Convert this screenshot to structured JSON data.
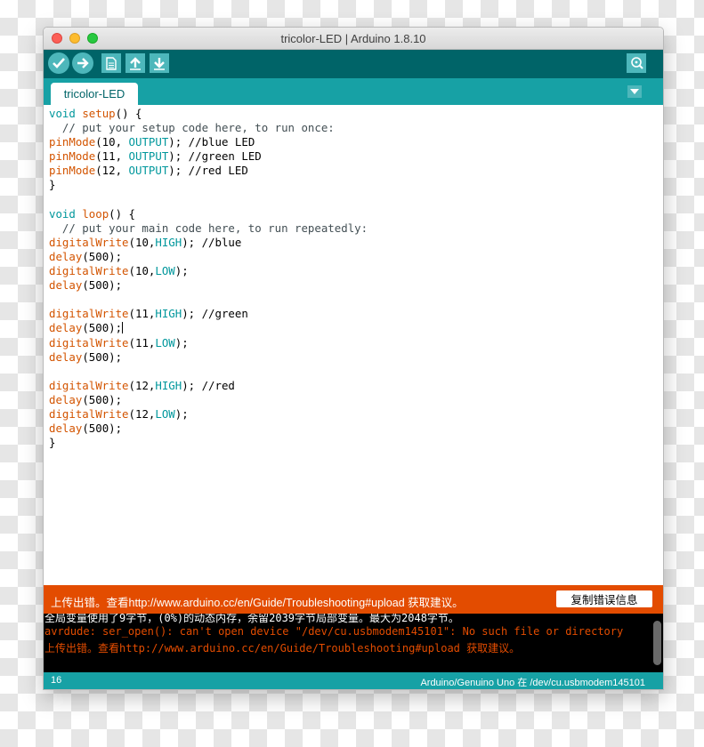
{
  "window": {
    "title": "tricolor-LED | Arduino 1.8.10"
  },
  "toolbar": {
    "buttons": [
      {
        "name": "verify",
        "icon": "checkmark-icon"
      },
      {
        "name": "upload",
        "icon": "arrow-right-icon"
      },
      {
        "name": "new",
        "icon": "document-icon"
      },
      {
        "name": "open",
        "icon": "arrow-up-icon"
      },
      {
        "name": "save",
        "icon": "arrow-down-icon"
      },
      {
        "name": "serial-monitor",
        "icon": "magnifier-icon"
      }
    ]
  },
  "tabs": {
    "active": "tricolor-LED",
    "menu_icon": "triangle-down-icon"
  },
  "editor": {
    "lines": [
      [
        {
          "t": "void",
          "c": "kw"
        },
        {
          "t": " "
        },
        {
          "t": "setup",
          "c": "fn"
        },
        {
          "t": "() {"
        }
      ],
      [
        {
          "t": "  // put your setup code here, to run once:",
          "c": "cm"
        }
      ],
      [
        {
          "t": "pinMode",
          "c": "fn"
        },
        {
          "t": "(10, "
        },
        {
          "t": "OUTPUT",
          "c": "kw"
        },
        {
          "t": "); //blue LED",
          "c": ""
        }
      ],
      [
        {
          "t": "pinMode",
          "c": "fn"
        },
        {
          "t": "(11, "
        },
        {
          "t": "OUTPUT",
          "c": "kw"
        },
        {
          "t": "); //green LED"
        }
      ],
      [
        {
          "t": "pinMode",
          "c": "fn"
        },
        {
          "t": "(12, "
        },
        {
          "t": "OUTPUT",
          "c": "kw"
        },
        {
          "t": "); //red LED"
        }
      ],
      [
        {
          "t": "}"
        }
      ],
      [
        {
          "t": ""
        }
      ],
      [
        {
          "t": "void",
          "c": "kw"
        },
        {
          "t": " "
        },
        {
          "t": "loop",
          "c": "fn"
        },
        {
          "t": "() {"
        }
      ],
      [
        {
          "t": "  // put your main code here, to run repeatedly:",
          "c": "cm"
        }
      ],
      [
        {
          "t": "digitalWrite",
          "c": "fn"
        },
        {
          "t": "(10,"
        },
        {
          "t": "HIGH",
          "c": "kw"
        },
        {
          "t": "); //blue"
        }
      ],
      [
        {
          "t": "delay",
          "c": "fn"
        },
        {
          "t": "(500);"
        }
      ],
      [
        {
          "t": "digitalWrite",
          "c": "fn"
        },
        {
          "t": "(10,"
        },
        {
          "t": "LOW",
          "c": "kw"
        },
        {
          "t": ");"
        }
      ],
      [
        {
          "t": "delay",
          "c": "fn"
        },
        {
          "t": "(500);"
        }
      ],
      [
        {
          "t": ""
        }
      ],
      [
        {
          "t": "digitalWrite",
          "c": "fn"
        },
        {
          "t": "(11,"
        },
        {
          "t": "HIGH",
          "c": "kw"
        },
        {
          "t": "); //green"
        }
      ],
      [
        {
          "t": "delay",
          "c": "fn"
        },
        {
          "t": "(500);"
        },
        {
          "t": "",
          "cursor": true
        }
      ],
      [
        {
          "t": "digitalWrite",
          "c": "fn"
        },
        {
          "t": "(11,"
        },
        {
          "t": "LOW",
          "c": "kw"
        },
        {
          "t": ");"
        }
      ],
      [
        {
          "t": "delay",
          "c": "fn"
        },
        {
          "t": "(500);"
        }
      ],
      [
        {
          "t": ""
        }
      ],
      [
        {
          "t": "digitalWrite",
          "c": "fn"
        },
        {
          "t": "(12,"
        },
        {
          "t": "HIGH",
          "c": "kw"
        },
        {
          "t": "); //red"
        }
      ],
      [
        {
          "t": "delay",
          "c": "fn"
        },
        {
          "t": "(500);"
        }
      ],
      [
        {
          "t": "digitalWrite",
          "c": "fn"
        },
        {
          "t": "(12,"
        },
        {
          "t": "LOW",
          "c": "kw"
        },
        {
          "t": ");"
        }
      ],
      [
        {
          "t": "delay",
          "c": "fn"
        },
        {
          "t": "(500);"
        }
      ],
      [
        {
          "t": "}"
        }
      ]
    ]
  },
  "error_bar": {
    "message": "上传出错。查看http://www.arduino.cc/en/Guide/Troubleshooting#upload 获取建议。",
    "copy_button": "复制错误信息"
  },
  "console": {
    "lines": [
      {
        "text": "全局变量使用了9字节，(0%)的动态内存，余留2039字节局部变量。最大为2048字节。",
        "color": "white"
      },
      {
        "text": "avrdude: ser_open(): can't open device \"/dev/cu.usbmodem145101\": No such file or directory",
        "color": "orange"
      },
      {
        "text": "上传出错。查看http://www.arduino.cc/en/Guide/Troubleshooting#upload 获取建议。",
        "color": "orange"
      }
    ]
  },
  "status": {
    "line_number": "16",
    "board_port": "Arduino/Genuino Uno 在 /dev/cu.usbmodem145101"
  },
  "colors": {
    "toolbar": "#006468",
    "tabbar": "#17a1a5",
    "button": "#4db7bb",
    "error": "#e34c00",
    "keyword": "#00979c",
    "function": "#d35400"
  }
}
